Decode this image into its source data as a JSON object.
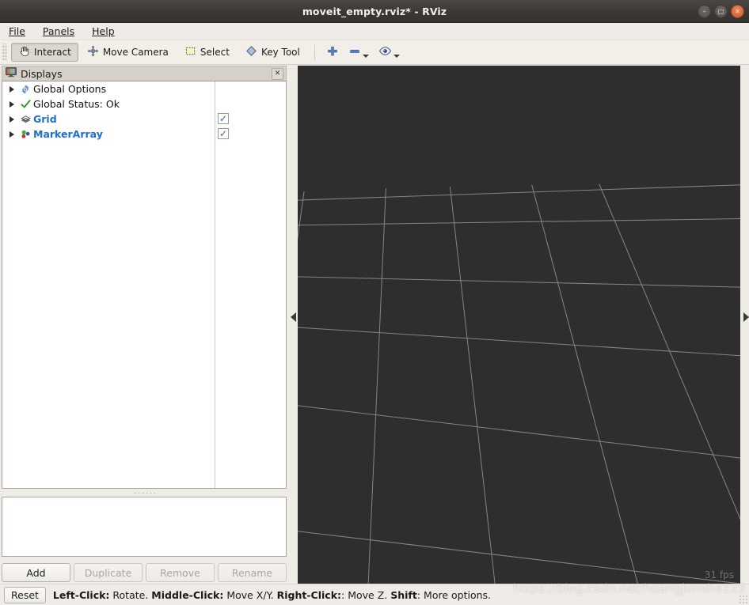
{
  "window": {
    "title": "moveit_empty.rviz* - RViz",
    "controls": [
      {
        "name": "minimize",
        "glyph": "–"
      },
      {
        "name": "maximize",
        "glyph": "□"
      },
      {
        "name": "close",
        "glyph": "✕"
      }
    ]
  },
  "menubar": {
    "items": [
      {
        "label": "File",
        "mnemonic": "F"
      },
      {
        "label": "Panels",
        "mnemonic": "P"
      },
      {
        "label": "Help",
        "mnemonic": "H"
      }
    ]
  },
  "toolbar": {
    "tools": [
      {
        "label": "Interact",
        "icon": "hand-icon",
        "pressed": true
      },
      {
        "label": "Move Camera",
        "icon": "move-camera-icon",
        "pressed": false
      },
      {
        "label": "Select",
        "icon": "select-rect-icon",
        "pressed": false
      },
      {
        "label": "Key Tool",
        "icon": "key-tool-icon",
        "pressed": false
      }
    ],
    "actions": [
      {
        "name": "add-tool",
        "icon": "plus-icon",
        "dropdown": false
      },
      {
        "name": "remove-tool",
        "icon": "minus-icon",
        "dropdown": true
      },
      {
        "name": "view-tool",
        "icon": "eye-icon",
        "dropdown": true
      }
    ]
  },
  "displays_panel": {
    "title": "Displays",
    "title_icon": "monitor-icon",
    "close_glyph": "✕",
    "columns": [
      "name",
      "enabled"
    ],
    "items": [
      {
        "label": "Global Options",
        "icon": "gear-icon",
        "link": false,
        "checkbox": null,
        "expandable": true
      },
      {
        "label": "Global Status: Ok",
        "icon": "check-icon",
        "link": false,
        "checkbox": null,
        "expandable": true
      },
      {
        "label": "Grid",
        "icon": "grid-icon",
        "link": true,
        "checkbox": true,
        "expandable": true
      },
      {
        "label": "MarkerArray",
        "icon": "markers-icon",
        "link": true,
        "checkbox": true,
        "expandable": true
      }
    ],
    "description": "",
    "buttons": [
      {
        "label": "Add",
        "enabled": true
      },
      {
        "label": "Duplicate",
        "enabled": false
      },
      {
        "label": "Remove",
        "enabled": false
      },
      {
        "label": "Rename",
        "enabled": false
      }
    ]
  },
  "splitters": {
    "left_handle_icon": "collapse-left-arrow",
    "right_handle_icon": "collapse-right-arrow"
  },
  "viewport": {
    "background_color": "#2e2e2e",
    "grid_line_color": "#8c8c8c",
    "fps": "31 fps",
    "watermark": "https://blog.csdn.net/huangjunsh4123"
  },
  "statusbar": {
    "reset_label": "Reset",
    "hints": [
      {
        "key": "Left-Click:",
        "action": " Rotate. "
      },
      {
        "key": "Middle-Click:",
        "action": " Move X/Y. "
      },
      {
        "key": "Right-Click:",
        "action": ": Move Z. "
      },
      {
        "key": "Shift",
        "action": ": More options."
      }
    ]
  },
  "colors": {
    "accent_link": "#1b6fd0",
    "checkbox": "#2b6cb8",
    "titlebar": "#3b3834",
    "panel_bg": "#efece7",
    "close_button": "#d3572c"
  }
}
